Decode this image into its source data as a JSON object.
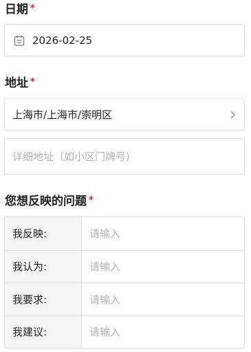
{
  "date": {
    "label": "日期",
    "required_mark": "*",
    "icon": "calendar-icon",
    "value": "2026-02-25"
  },
  "address": {
    "label": "地址",
    "required_mark": "*",
    "region": "上海市/上海市/崇明区",
    "region_icon": "chevron-right-icon",
    "detail_placeholder": "详细地址（如小区门牌号)"
  },
  "issue": {
    "label": "您想反映的问题",
    "required_mark": "*",
    "rows": [
      {
        "label": "我反映:",
        "placeholder": "请输入"
      },
      {
        "label": "我认为:",
        "placeholder": "请输入"
      },
      {
        "label": "我要求:",
        "placeholder": "请输入"
      },
      {
        "label": "我建议:",
        "placeholder": "请输入"
      }
    ]
  },
  "colors": {
    "required": "#e0202a",
    "border": "#dedede",
    "label_bg": "#f6f6f6",
    "placeholder": "#b3b3b3"
  }
}
